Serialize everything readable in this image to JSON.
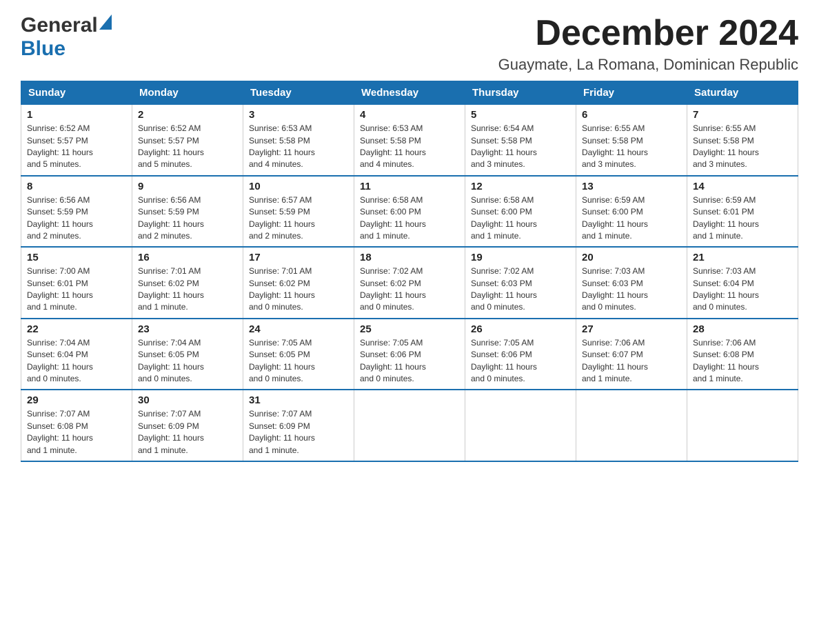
{
  "logo": {
    "general": "General",
    "blue": "Blue"
  },
  "title": "December 2024",
  "subtitle": "Guaymate, La Romana, Dominican Republic",
  "days": [
    "Sunday",
    "Monday",
    "Tuesday",
    "Wednesday",
    "Thursday",
    "Friday",
    "Saturday"
  ],
  "weeks": [
    [
      {
        "day": "1",
        "sunrise": "6:52 AM",
        "sunset": "5:57 PM",
        "daylight": "11 hours and 5 minutes."
      },
      {
        "day": "2",
        "sunrise": "6:52 AM",
        "sunset": "5:57 PM",
        "daylight": "11 hours and 5 minutes."
      },
      {
        "day": "3",
        "sunrise": "6:53 AM",
        "sunset": "5:58 PM",
        "daylight": "11 hours and 4 minutes."
      },
      {
        "day": "4",
        "sunrise": "6:53 AM",
        "sunset": "5:58 PM",
        "daylight": "11 hours and 4 minutes."
      },
      {
        "day": "5",
        "sunrise": "6:54 AM",
        "sunset": "5:58 PM",
        "daylight": "11 hours and 3 minutes."
      },
      {
        "day": "6",
        "sunrise": "6:55 AM",
        "sunset": "5:58 PM",
        "daylight": "11 hours and 3 minutes."
      },
      {
        "day": "7",
        "sunrise": "6:55 AM",
        "sunset": "5:58 PM",
        "daylight": "11 hours and 3 minutes."
      }
    ],
    [
      {
        "day": "8",
        "sunrise": "6:56 AM",
        "sunset": "5:59 PM",
        "daylight": "11 hours and 2 minutes."
      },
      {
        "day": "9",
        "sunrise": "6:56 AM",
        "sunset": "5:59 PM",
        "daylight": "11 hours and 2 minutes."
      },
      {
        "day": "10",
        "sunrise": "6:57 AM",
        "sunset": "5:59 PM",
        "daylight": "11 hours and 2 minutes."
      },
      {
        "day": "11",
        "sunrise": "6:58 AM",
        "sunset": "6:00 PM",
        "daylight": "11 hours and 1 minute."
      },
      {
        "day": "12",
        "sunrise": "6:58 AM",
        "sunset": "6:00 PM",
        "daylight": "11 hours and 1 minute."
      },
      {
        "day": "13",
        "sunrise": "6:59 AM",
        "sunset": "6:00 PM",
        "daylight": "11 hours and 1 minute."
      },
      {
        "day": "14",
        "sunrise": "6:59 AM",
        "sunset": "6:01 PM",
        "daylight": "11 hours and 1 minute."
      }
    ],
    [
      {
        "day": "15",
        "sunrise": "7:00 AM",
        "sunset": "6:01 PM",
        "daylight": "11 hours and 1 minute."
      },
      {
        "day": "16",
        "sunrise": "7:01 AM",
        "sunset": "6:02 PM",
        "daylight": "11 hours and 1 minute."
      },
      {
        "day": "17",
        "sunrise": "7:01 AM",
        "sunset": "6:02 PM",
        "daylight": "11 hours and 0 minutes."
      },
      {
        "day": "18",
        "sunrise": "7:02 AM",
        "sunset": "6:02 PM",
        "daylight": "11 hours and 0 minutes."
      },
      {
        "day": "19",
        "sunrise": "7:02 AM",
        "sunset": "6:03 PM",
        "daylight": "11 hours and 0 minutes."
      },
      {
        "day": "20",
        "sunrise": "7:03 AM",
        "sunset": "6:03 PM",
        "daylight": "11 hours and 0 minutes."
      },
      {
        "day": "21",
        "sunrise": "7:03 AM",
        "sunset": "6:04 PM",
        "daylight": "11 hours and 0 minutes."
      }
    ],
    [
      {
        "day": "22",
        "sunrise": "7:04 AM",
        "sunset": "6:04 PM",
        "daylight": "11 hours and 0 minutes."
      },
      {
        "day": "23",
        "sunrise": "7:04 AM",
        "sunset": "6:05 PM",
        "daylight": "11 hours and 0 minutes."
      },
      {
        "day": "24",
        "sunrise": "7:05 AM",
        "sunset": "6:05 PM",
        "daylight": "11 hours and 0 minutes."
      },
      {
        "day": "25",
        "sunrise": "7:05 AM",
        "sunset": "6:06 PM",
        "daylight": "11 hours and 0 minutes."
      },
      {
        "day": "26",
        "sunrise": "7:05 AM",
        "sunset": "6:06 PM",
        "daylight": "11 hours and 0 minutes."
      },
      {
        "day": "27",
        "sunrise": "7:06 AM",
        "sunset": "6:07 PM",
        "daylight": "11 hours and 1 minute."
      },
      {
        "day": "28",
        "sunrise": "7:06 AM",
        "sunset": "6:08 PM",
        "daylight": "11 hours and 1 minute."
      }
    ],
    [
      {
        "day": "29",
        "sunrise": "7:07 AM",
        "sunset": "6:08 PM",
        "daylight": "11 hours and 1 minute."
      },
      {
        "day": "30",
        "sunrise": "7:07 AM",
        "sunset": "6:09 PM",
        "daylight": "11 hours and 1 minute."
      },
      {
        "day": "31",
        "sunrise": "7:07 AM",
        "sunset": "6:09 PM",
        "daylight": "11 hours and 1 minute."
      },
      null,
      null,
      null,
      null
    ]
  ],
  "labels": {
    "sunrise": "Sunrise:",
    "sunset": "Sunset:",
    "daylight": "Daylight:"
  },
  "colors": {
    "header_bg": "#1a6faf",
    "header_text": "#ffffff",
    "border": "#1a6faf"
  }
}
